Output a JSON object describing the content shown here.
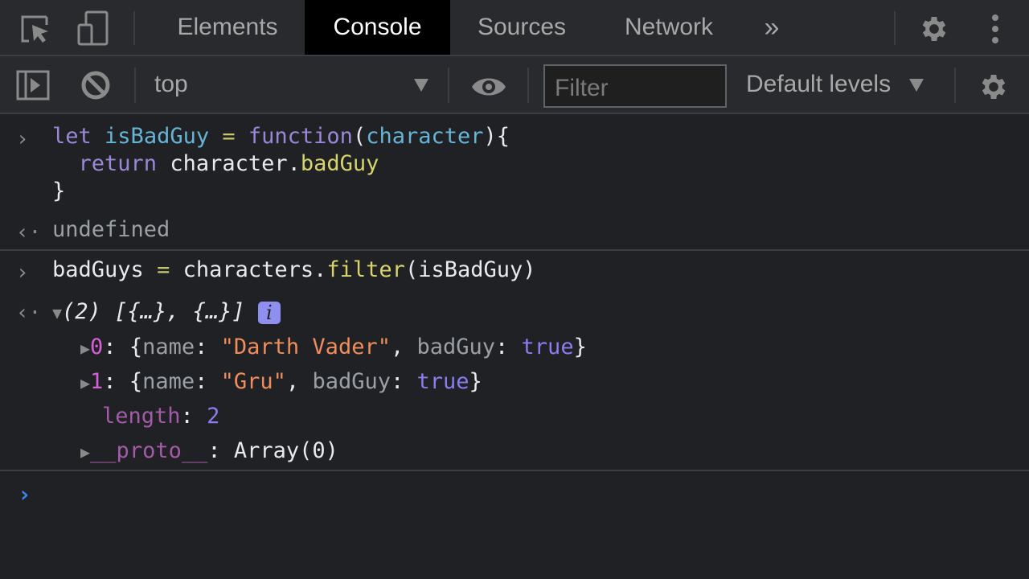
{
  "tabs": {
    "items": [
      {
        "label": "Elements",
        "active": false
      },
      {
        "label": "Console",
        "active": true
      },
      {
        "label": "Sources",
        "active": false
      },
      {
        "label": "Network",
        "active": false
      }
    ],
    "more": "»"
  },
  "icons": {
    "inspect": "inspect-element-icon",
    "device": "device-toolbar-icon",
    "settings": "gear-icon",
    "menu": "kebab-menu-icon",
    "sidebar": "sidebar-toggle-icon",
    "clear": "clear-console-icon",
    "eye": "live-expression-icon"
  },
  "toolbar": {
    "context": "top",
    "filter_placeholder": "Filter",
    "levels": "Default levels"
  },
  "console": {
    "entry1": {
      "line1": {
        "kw1": "let",
        "var": "isBadGuy",
        "op": "=",
        "kw2": "function",
        "paren_open": "(",
        "param": "character",
        "rest": "){"
      },
      "line2": {
        "kw": "return",
        "obj": "character.",
        "prop": "badGuy"
      },
      "line3": "}",
      "result": "undefined"
    },
    "entry2": {
      "input": {
        "lhs": "badGuys",
        "op": "=",
        "obj": "characters.",
        "method": "filter",
        "args": "(isBadGuy)"
      },
      "summary": "(2) [{…}, {…}]",
      "info": "i",
      "items": [
        {
          "index": "0",
          "open": ": {",
          "key1": "name",
          "colon1": ": ",
          "val1": "\"Darth Vader\"",
          "sep": ", ",
          "key2": "badGuy",
          "colon2": ": ",
          "val2": "true",
          "close": "}"
        },
        {
          "index": "1",
          "open": ": {",
          "key1": "name",
          "colon1": ": ",
          "val1": "\"Gru\"",
          "sep": ", ",
          "key2": "badGuy",
          "colon2": ": ",
          "val2": "true",
          "close": "}"
        }
      ],
      "length_key": "length",
      "length_val": "2",
      "proto_key": "__proto__",
      "proto_val": "Array(0)"
    }
  },
  "colors": {
    "prompt": "#3d85f2",
    "active_tab_bg": "#000000"
  }
}
